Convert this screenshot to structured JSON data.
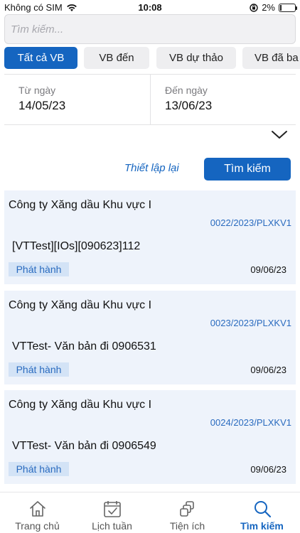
{
  "status_bar": {
    "carrier": "Không có SIM",
    "time": "10:08",
    "battery": "2%"
  },
  "search": {
    "placeholder": "Tìm kiếm..."
  },
  "tabs": [
    {
      "label": "Tất cả VB",
      "active": true
    },
    {
      "label": "VB đến",
      "active": false
    },
    {
      "label": "VB dự thảo",
      "active": false
    },
    {
      "label": "VB đã ba",
      "active": false
    }
  ],
  "filter": {
    "from_label": "Từ ngày",
    "from_value": "14/05/23",
    "to_label": "Đến ngày",
    "to_value": "13/06/23",
    "reset_label": "Thiết lập lại",
    "search_label": "Tìm kiếm"
  },
  "documents": [
    {
      "org": "Công ty Xăng dầu Khu vực I",
      "code": "0022/2023/PLXKV1",
      "title": "[VTTest][IOs][090623]112",
      "status": "Phát hành",
      "date": "09/06/23"
    },
    {
      "org": "Công ty Xăng dầu Khu vực I",
      "code": "0023/2023/PLXKV1",
      "title": "VTTest- Văn bản đi 0906531",
      "status": "Phát hành",
      "date": "09/06/23"
    },
    {
      "org": "Công ty Xăng dầu Khu vực I",
      "code": "0024/2023/PLXKV1",
      "title": "VTTest- Văn bản đi 0906549",
      "status": "Phát hành",
      "date": "09/06/23"
    }
  ],
  "bottom_nav": [
    {
      "label": "Trang chủ",
      "icon": "home-icon",
      "active": false
    },
    {
      "label": "Lịch tuần",
      "icon": "calendar-icon",
      "active": false
    },
    {
      "label": "Tiện ích",
      "icon": "utilities-icon",
      "active": false
    },
    {
      "label": "Tìm kiếm",
      "icon": "search-icon",
      "active": true
    }
  ],
  "colors": {
    "accent": "#1565c0",
    "card_bg": "#eef3fb",
    "badge_bg": "#d3e3f6",
    "code_text": "#2a6bbf"
  }
}
